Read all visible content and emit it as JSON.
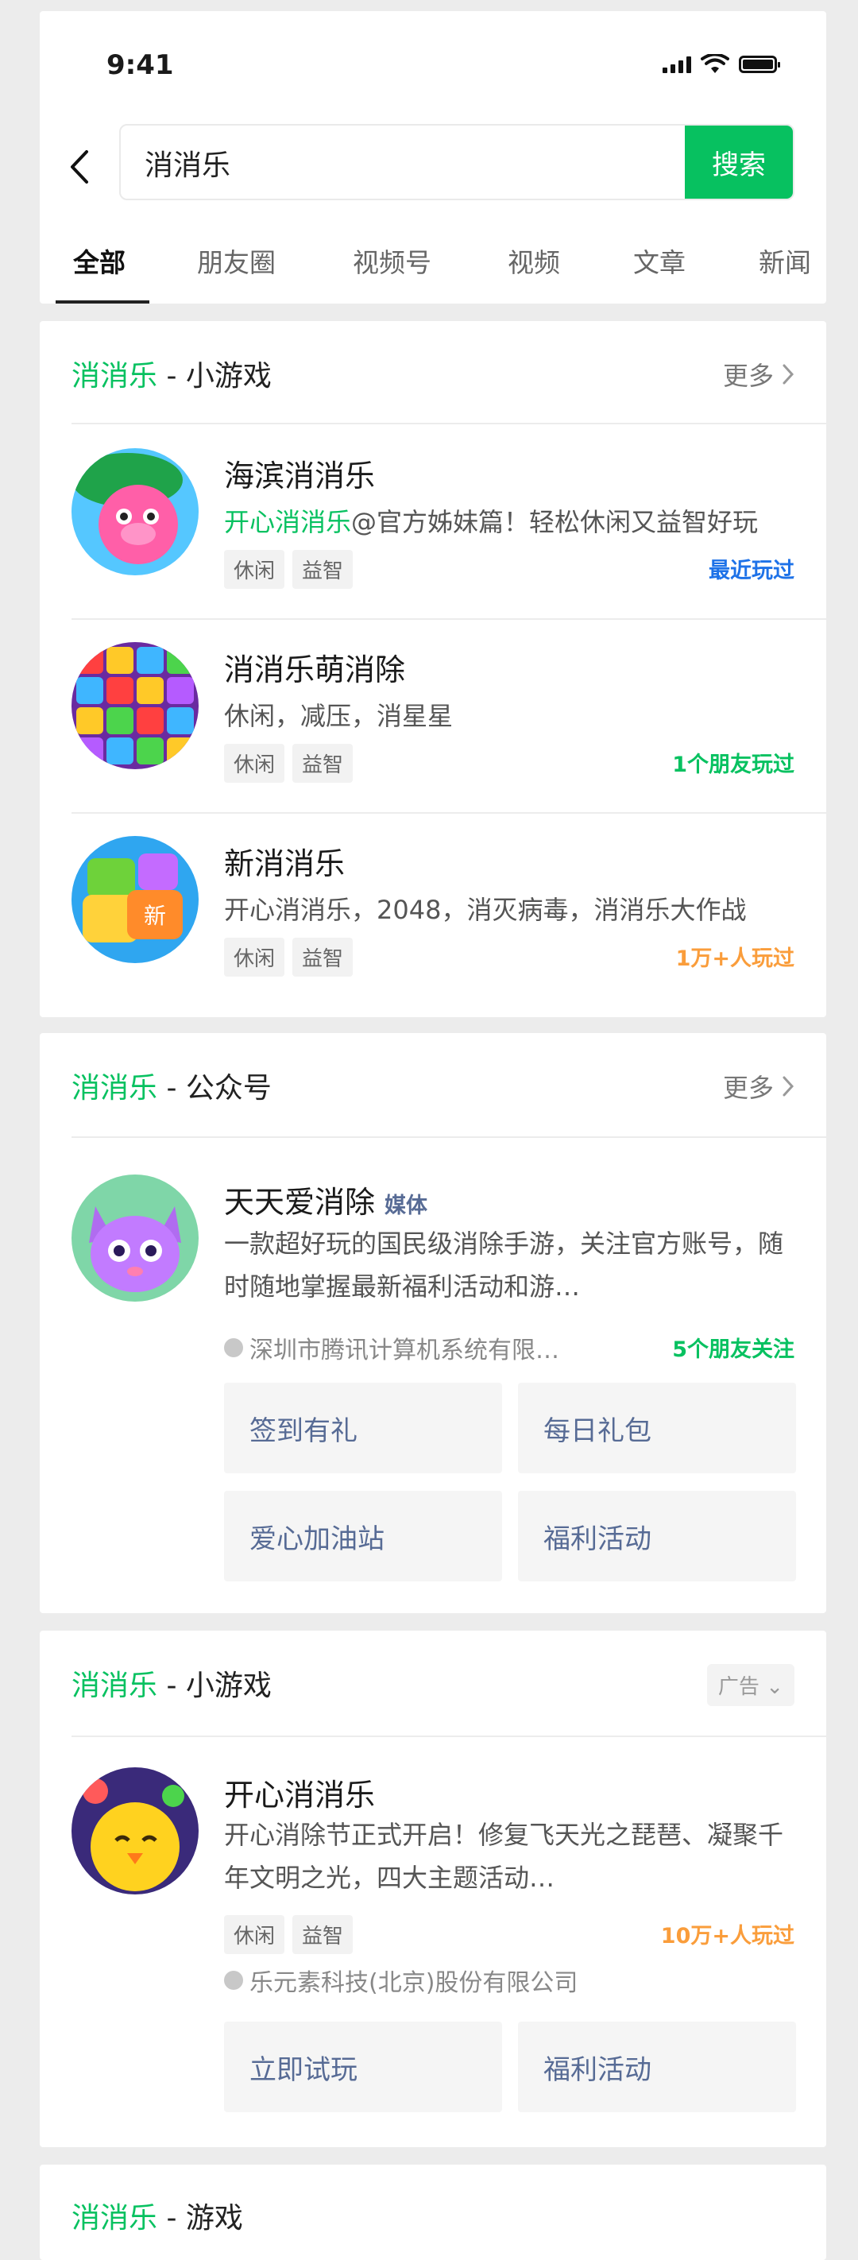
{
  "status_bar": {
    "time": "9:41"
  },
  "search": {
    "query": "消消乐",
    "button_label": "搜索"
  },
  "tabs": [
    {
      "label": "全部",
      "active": true
    },
    {
      "label": "朋友圈"
    },
    {
      "label": "视频号"
    },
    {
      "label": "视频"
    },
    {
      "label": "文章"
    },
    {
      "label": "新闻"
    }
  ],
  "section_games": {
    "keyword": "消消乐",
    "title": " - 小游戏",
    "more_label": "更多",
    "items": [
      {
        "title": "海滨消消乐",
        "desc_highlight": "开心消消乐",
        "desc": "@官方姊妹篇！轻松休闲又益智好玩",
        "tags": [
          "休闲",
          "益智"
        ],
        "status": "最近玩过",
        "status_color": "#1e72e8"
      },
      {
        "title": "消消乐萌消除",
        "desc": "休闲，减压，消星星",
        "tags": [
          "休闲",
          "益智"
        ],
        "status": "1个朋友玩过",
        "status_color": "#07c160"
      },
      {
        "title": "新消消乐",
        "desc": "开心消消乐，2048，消灭病毒，消消乐大作战",
        "tags": [
          "休闲",
          "益智"
        ],
        "status": "1万+人玩过",
        "status_color": "#fa9d3b"
      }
    ]
  },
  "section_accounts": {
    "keyword": "消消乐",
    "title": " - 公众号",
    "more_label": "更多",
    "account": {
      "name": "天天爱消除",
      "badge": "媒体",
      "desc": "一款超好玩的国民级消除手游，关注官方账号，随时随地掌握最新福利活动和游…",
      "org": "深圳市腾讯计算机系统有限…",
      "friends": "5个朋友关注"
    },
    "services": [
      "签到有礼",
      "每日礼包",
      "爱心加油站",
      "福利活动"
    ]
  },
  "section_ad": {
    "keyword": "消消乐",
    "title": " - 小游戏",
    "ad_label": "广告",
    "game": {
      "title": "开心消消乐",
      "desc": "开心消除节正式开启！修复飞天光之琵琶、凝聚千年文明之光，四大主题活动…",
      "tags": [
        "休闲",
        "益智"
      ],
      "status": "10万+人玩过",
      "status_color": "#fa9d3b",
      "org": "乐元素科技(北京)股份有限公司"
    },
    "buttons": [
      "立即试玩",
      "福利活动"
    ]
  },
  "section_more": {
    "keyword": "消消乐",
    "title": " - 游戏"
  }
}
